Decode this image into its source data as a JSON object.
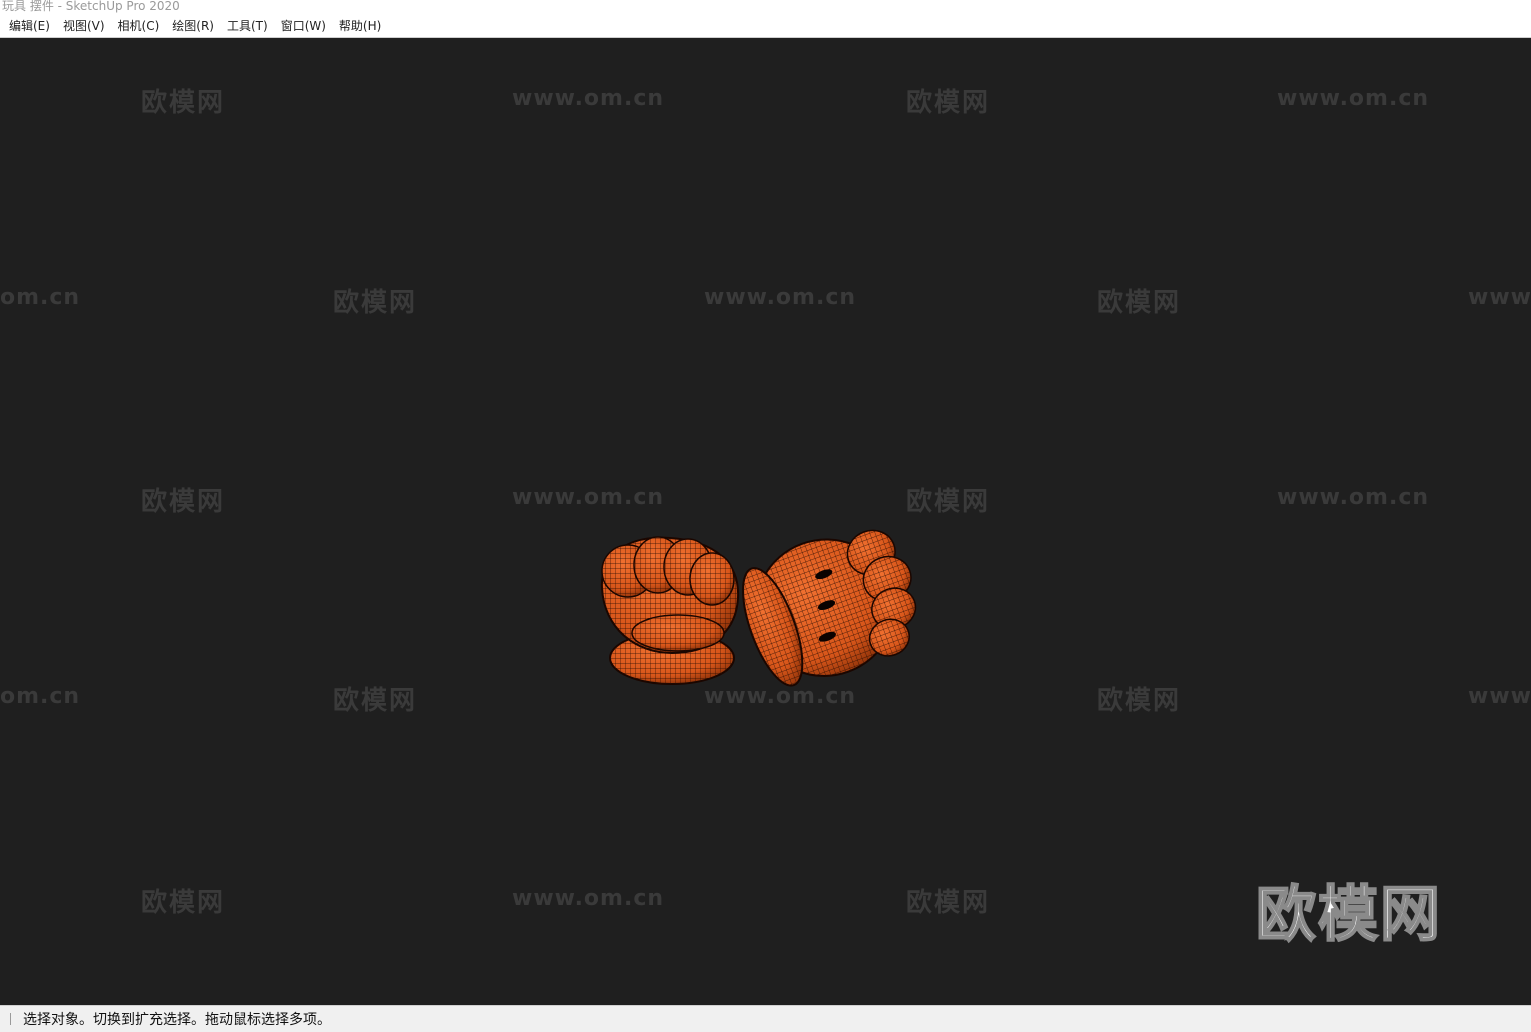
{
  "window": {
    "title": "玩具 摆件 - SketchUp Pro 2020"
  },
  "menubar": {
    "items": [
      {
        "label": "编辑(E)"
      },
      {
        "label": "视图(V)"
      },
      {
        "label": "相机(C)"
      },
      {
        "label": "绘图(R)"
      },
      {
        "label": "工具(T)"
      },
      {
        "label": "窗口(W)"
      },
      {
        "label": "帮助(H)"
      }
    ]
  },
  "viewport": {
    "background_color": "#1f1f1f",
    "model_color": "#d8561a",
    "watermarks": {
      "logo_text": "欧模网",
      "url_text": "www.om.cn",
      "url_partial_left": "om.cn",
      "url_partial_right": "www."
    },
    "corner_logo": "欧模网"
  },
  "statusbar": {
    "message": "选择对象。切换到扩充选择。拖动鼠标选择多项。"
  }
}
